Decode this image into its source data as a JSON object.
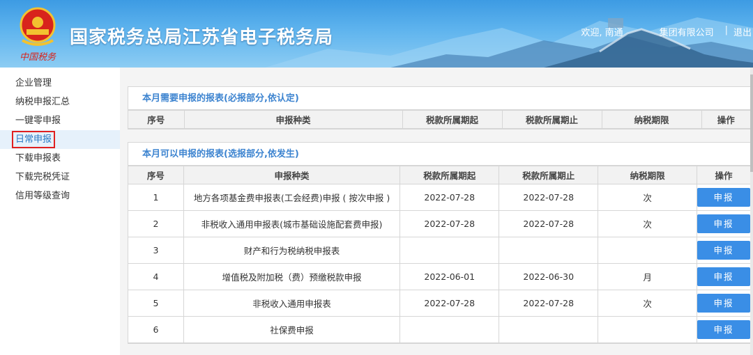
{
  "header": {
    "title": "国家税务总局江苏省电子税务局",
    "emblem_text": "中国税务",
    "welcome": "欢迎, 南通",
    "company": "集团有限公司",
    "separator": "|",
    "logout": "退出"
  },
  "sidebar": {
    "items": [
      {
        "label": "企业管理"
      },
      {
        "label": "纳税申报汇总"
      },
      {
        "label": "一键零申报"
      },
      {
        "label": "日常申报"
      },
      {
        "label": "下载申报表"
      },
      {
        "label": "下载完税凭证"
      },
      {
        "label": "信用等级查询"
      }
    ],
    "active_index": 3
  },
  "required_panel": {
    "title": "本月需要申报的报表(必报部分,依认定)",
    "columns": [
      "序号",
      "申报种类",
      "税款所属期起",
      "税款所属期止",
      "纳税期限",
      "操作"
    ]
  },
  "optional_panel": {
    "title": "本月可以申报的报表(选报部分,依发生)",
    "columns": [
      "序号",
      "申报种类",
      "税款所属期起",
      "税款所属期止",
      "纳税期限",
      "操作"
    ],
    "rows": [
      {
        "no": "1",
        "type": "地方各项基金费申报表(工会经费)申报 ( 按次申报 )",
        "start": "2022-07-28",
        "end": "2022-07-28",
        "period": "次",
        "action": "申报"
      },
      {
        "no": "2",
        "type": "非税收入通用申报表(城市基础设施配套费申报)",
        "start": "2022-07-28",
        "end": "2022-07-28",
        "period": "次",
        "action": "申报"
      },
      {
        "no": "3",
        "type": "财产和行为税纳税申报表",
        "start": "",
        "end": "",
        "period": "",
        "action": "申报"
      },
      {
        "no": "4",
        "type": "增值税及附加税（费）预缴税款申报",
        "start": "2022-06-01",
        "end": "2022-06-30",
        "period": "月",
        "action": "申报"
      },
      {
        "no": "5",
        "type": "非税收入通用申报表",
        "start": "2022-07-28",
        "end": "2022-07-28",
        "period": "次",
        "action": "申报"
      },
      {
        "no": "6",
        "type": "社保费申报",
        "start": "",
        "end": "",
        "period": "",
        "action": "申报"
      }
    ]
  },
  "colors": {
    "accent": "#3a8ee6",
    "panel_title": "#3d84d0",
    "active_highlight": "#e02020"
  }
}
